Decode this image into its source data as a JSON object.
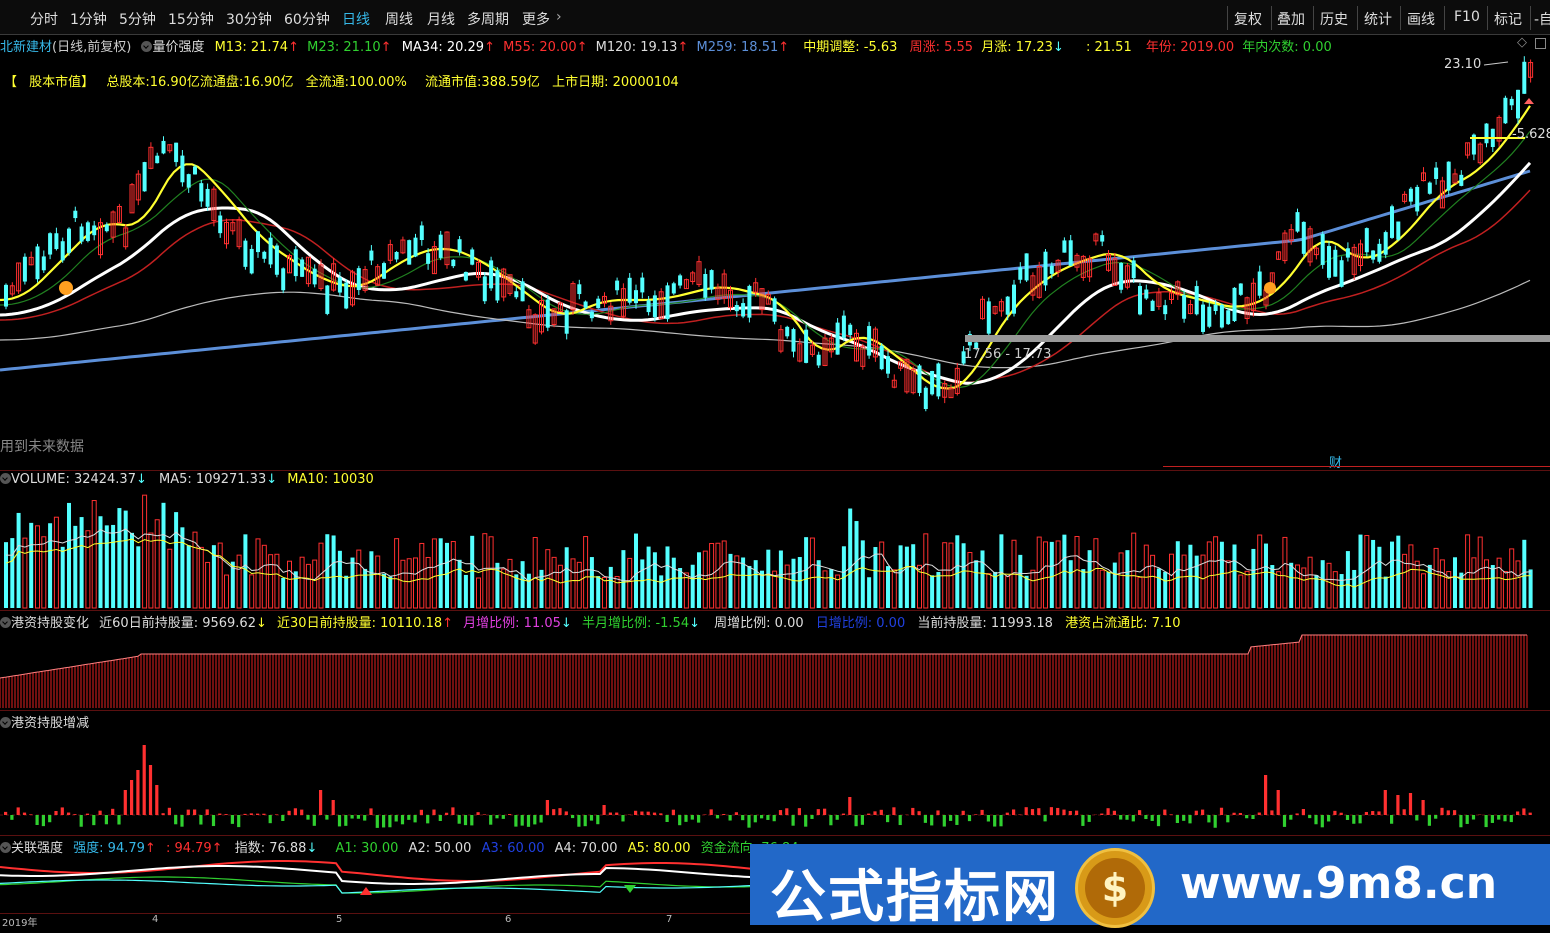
{
  "toolbar": {
    "periods": [
      "分时",
      "1分钟",
      "5分钟",
      "15分钟",
      "30分钟",
      "60分钟",
      "日线",
      "周线",
      "月线",
      "多周期",
      "更多"
    ],
    "active_period": "日线",
    "right_buttons": [
      "复权",
      "叠加",
      "历史",
      "统计",
      "画线",
      "F10",
      "标记",
      "-自"
    ]
  },
  "header": {
    "stock_name": "北新建材",
    "mode": "(日线,前复权)",
    "indicator": "量价强度",
    "m13": "M13: 21.74",
    "m23": "M23: 21.10",
    "ma34": "MA34: 20.29",
    "m55": "M55: 20.00",
    "m120": "M120: 19.13",
    "m259": "M259: 18.51",
    "mid_adjust": "中期调整: -5.63",
    "week_rise": "周涨: 5.55",
    "month_rise": "月涨: 17.23",
    "extra": ": 21.51",
    "year": "年份: 2019.00",
    "year_count": "年内次数: 0.00"
  },
  "equity": {
    "bracket_open": "【",
    "title": "股本市值】",
    "total_shares": "总股本:16.90亿",
    "float_shares": "流通盘:16.90亿",
    "full_float": "全流通:100.00%",
    "float_value": "流通市值:388.59亿",
    "listing_date": "上市日期: 20000104"
  },
  "price_chart": {
    "high_label": "23.10",
    "right_label": "-5.628",
    "range_label": "17.56 - 17.73",
    "future_note": "用到未来数据",
    "finance_mark": "财"
  },
  "volume": {
    "label": "VOLUME: 32424.37",
    "ma5": "MA5: 109271.33",
    "ma10": "MA10: 10030"
  },
  "hk_change": {
    "title": "港资持股变化",
    "d60": "近60日前持股量: 9569.62",
    "d30": "近30日前持股量: 10110.18",
    "month_ratio": "月增比例: 11.05",
    "half_month": "半月增比例: -1.54",
    "week_ratio": "周增比例: 0.00",
    "day_ratio": "日增比例: 0.00",
    "current": "当前持股量: 11993.18",
    "float_ratio": "港资占流通比: 7.10"
  },
  "hk_delta": {
    "title": "港资持股增减"
  },
  "relation": {
    "title": "关联强度",
    "strength": "强度: 94.79",
    "strength2": ": 94.79",
    "index": "指数: 76.88",
    "a1": "A1: 30.00",
    "a2": "A2: 50.00",
    "a3": "A3: 60.00",
    "a4": "A4: 70.00",
    "a5": "A5: 80.00",
    "fund": "资金流向: 76.84"
  },
  "xaxis": {
    "year_label": "2019年",
    "months": [
      "4",
      "5",
      "6",
      "7"
    ]
  },
  "watermark": {
    "cn": "公式指标网",
    "url": "www.9m8.cn"
  },
  "colors": {
    "up": "#ff3030",
    "down": "#54ffff",
    "active_tab": "#36b8e8",
    "ma_yellow": "#ffff30",
    "ma_white": "#ffffff",
    "ma_blue": "#5c8fd8",
    "ma_red": "#c02020",
    "ma_green": "#208020",
    "watermark_bg": "#2268c8"
  },
  "chart_data": {
    "type": "candlestick-with-indicators",
    "price_ylim": [
      16.5,
      23.5
    ],
    "ma_last": {
      "M13": 21.74,
      "M23": 21.1,
      "MA34": 20.29,
      "M55": 20.0,
      "M120": 19.13,
      "M259": 18.51
    },
    "high": 23.1,
    "low_range": [
      17.56,
      17.73
    ]
  }
}
